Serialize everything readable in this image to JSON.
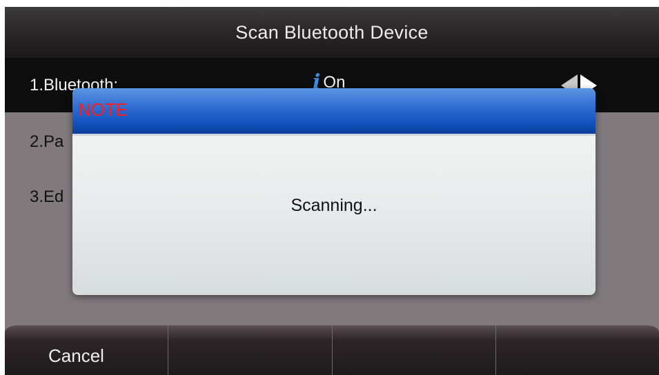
{
  "header": {
    "title": "Scan Bluetooth Device"
  },
  "menu": {
    "items": [
      {
        "label": "1.Bluetooth:",
        "value": "On",
        "icon": "info-icon"
      },
      {
        "label": "2.Pa"
      },
      {
        "label": "3.Ed"
      }
    ]
  },
  "dialog": {
    "title": "NOTE",
    "message": "Scanning..."
  },
  "softkeys": [
    "Cancel",
    "",
    "",
    ""
  ],
  "colors": {
    "title_bar": "#2a2829",
    "selected_row": "#0d0d0d",
    "dialog_header": "#1452c0",
    "dialog_title_text": "#ff1c1c",
    "info_icon": "#3d8de0"
  }
}
